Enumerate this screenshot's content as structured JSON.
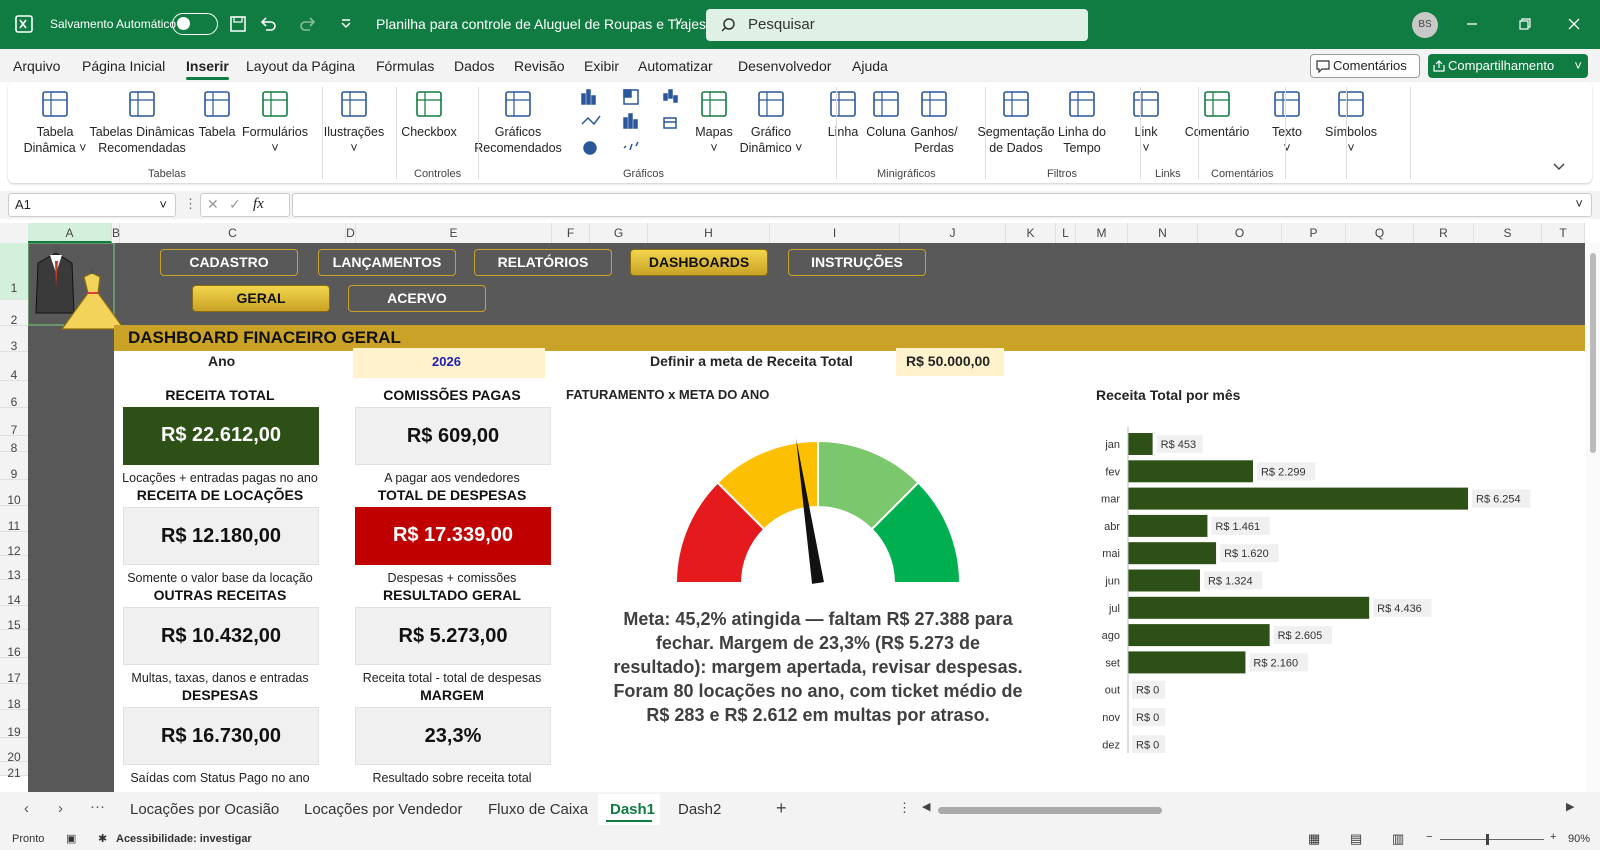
{
  "titlebar": {
    "autosave_label": "Salvamento Automático",
    "document_title": "Planilha para controle de Aluguel de Roupas e Trajes",
    "search_placeholder": "Pesquisar",
    "user_initials": "BS"
  },
  "menu": [
    "Arquivo",
    "Página Inicial",
    "Inserir",
    "Layout da Página",
    "Fórmulas",
    "Dados",
    "Revisão",
    "Exibir",
    "Automatizar",
    "Desenvolvedor",
    "Ajuda"
  ],
  "menu_active": "Inserir",
  "header_buttons": {
    "comments": "Comentários",
    "share": "Compartilhamento"
  },
  "ribbon": {
    "items": [
      {
        "l1": "Tabela",
        "l2": "Dinâmica ˅"
      },
      {
        "l1": "Tabelas Dinâmicas",
        "l2": "Recomendadas"
      },
      {
        "l1": "Tabela",
        "l2": ""
      },
      {
        "l1": "Formulários",
        "l2": "˅"
      },
      {
        "l1": "Ilustrações",
        "l2": "˅"
      },
      {
        "l1": "Checkbox",
        "l2": ""
      },
      {
        "l1": "Gráficos",
        "l2": "Recomendados"
      },
      {
        "l1": "Mapas",
        "l2": "˅"
      },
      {
        "l1": "Gráfico",
        "l2": "Dinâmico ˅"
      },
      {
        "l1": "Linha",
        "l2": ""
      },
      {
        "l1": "Coluna",
        "l2": ""
      },
      {
        "l1": "Ganhos/",
        "l2": "Perdas"
      },
      {
        "l1": "Segmentação",
        "l2": "de Dados"
      },
      {
        "l1": "Linha do",
        "l2": "Tempo"
      },
      {
        "l1": "Link",
        "l2": "˅"
      },
      {
        "l1": "Comentário",
        "l2": ""
      },
      {
        "l1": "Texto",
        "l2": "˅"
      },
      {
        "l1": "Símbolos",
        "l2": "˅"
      }
    ],
    "groups": [
      "Tabelas",
      "Controles",
      "Gráficos",
      "Minigráficos",
      "Filtros",
      "Links",
      "Comentários"
    ]
  },
  "formula_bar": {
    "name_box": "A1",
    "fx": "fx"
  },
  "columns": [
    "A",
    "B",
    "C",
    "D",
    "E",
    "F",
    "G",
    "H",
    "I",
    "J",
    "K",
    "L",
    "M",
    "N",
    "O",
    "P",
    "Q",
    "R",
    "S",
    "T"
  ],
  "rows": [
    "1",
    "2",
    "3",
    "4",
    "6",
    "7",
    "8",
    "9",
    "10",
    "11",
    "12",
    "13",
    "14",
    "15",
    "16",
    "17",
    "18",
    "19",
    "20",
    "21"
  ],
  "dashboard": {
    "nav_row1": [
      "CADASTRO",
      "LANÇAMENTOS",
      "RELATÓRIOS",
      "DASHBOARDS",
      "INSTRUÇÕES"
    ],
    "nav_row2": [
      "GERAL",
      "ACERVO"
    ],
    "title": "DASHBOARD FINACEIRO GERAL",
    "year_label": "Ano",
    "year_value": "2026",
    "goal_label": "Definir a meta de Receita Total",
    "goal_value": "R$ 50.000,00",
    "cards": [
      {
        "title": "RECEITA TOTAL",
        "value": "R$ 22.612,00",
        "sub": "Locações + entradas pagas no ano",
        "style": "green"
      },
      {
        "title": "COMISSÕES PAGAS",
        "value": "R$ 609,00",
        "sub": "A pagar aos vendedores",
        "style": "plain"
      },
      {
        "title": "RECEITA DE LOCAÇÕES",
        "value": "R$ 12.180,00",
        "sub": "Somente o valor base da locação",
        "style": "plain"
      },
      {
        "title": "TOTAL DE DESPESAS",
        "value": "R$ 17.339,00",
        "sub": "Despesas + comissões",
        "style": "red"
      },
      {
        "title": "OUTRAS RECEITAS",
        "value": "R$ 10.432,00",
        "sub": "Multas, taxas, danos e entradas",
        "style": "plain"
      },
      {
        "title": "RESULTADO GERAL",
        "value": "R$ 5.273,00",
        "sub": "Receita total - total de despesas",
        "style": "plain"
      },
      {
        "title": "DESPESAS",
        "value": "R$ 16.730,00",
        "sub": "Saídas com Status Pago no ano",
        "style": "plain"
      },
      {
        "title": "MARGEM",
        "value": "23,3%",
        "sub": "Resultado sobre receita total",
        "style": "plain"
      }
    ],
    "gauge": {
      "title": "FATURAMENTO x META DO ANO",
      "achieved_fraction": 0.452,
      "colors": [
        "#e41a1c",
        "#fcbf01",
        "#7bc86c",
        "#00b050"
      ],
      "summary": "Meta: 45,2% atingida — faltam R$ 27.388 para fechar. Margem de 23,3% (R$ 5.273 de resultado): margem apertada, revisar despesas. Foram 80 locações no ano, com ticket médio de R$ 283 e R$ 2.612 em multas por atraso."
    }
  },
  "chart_data": {
    "type": "bar",
    "orientation": "horizontal",
    "title": "Receita Total por mês",
    "categories": [
      "jan",
      "fev",
      "mar",
      "abr",
      "mai",
      "jun",
      "jul",
      "ago",
      "set",
      "out",
      "nov",
      "dez"
    ],
    "values": [
      453,
      2299,
      6254,
      1461,
      1620,
      1324,
      4436,
      2605,
      2160,
      0,
      0,
      0
    ],
    "labels": [
      "R$ 453",
      "R$ 2.299",
      "R$ 6.254",
      "R$ 1.461",
      "R$ 1.620",
      "R$ 1.324",
      "R$ 4.436",
      "R$ 2.605",
      "R$ 2.160",
      "R$ 0",
      "R$ 0",
      "R$ 0"
    ],
    "color": "#2d5016"
  },
  "sheet_tabs": [
    "Locações por Ocasião",
    "Locações por Vendedor",
    "Fluxo de Caixa",
    "Dash1",
    "Dash2"
  ],
  "active_tab": "Dash1",
  "status": {
    "ready": "Pronto",
    "accessibility": "Acessibilidade: investigar",
    "zoom": "90%"
  }
}
